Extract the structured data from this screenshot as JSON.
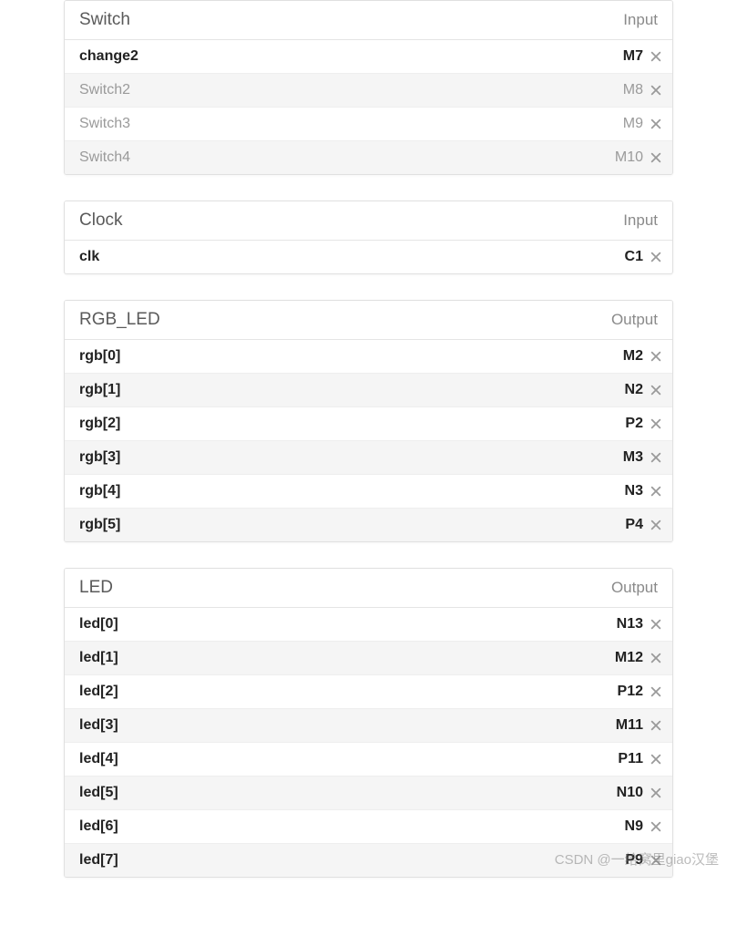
{
  "watermark": "CSDN @一给窝里giao汉堡",
  "panels": [
    {
      "title": "Switch",
      "direction": "Input",
      "rows": [
        {
          "name": "change2",
          "pin": "M7",
          "disabled": false,
          "alt": false
        },
        {
          "name": "Switch2",
          "pin": "M8",
          "disabled": true,
          "alt": true
        },
        {
          "name": "Switch3",
          "pin": "M9",
          "disabled": true,
          "alt": false
        },
        {
          "name": "Switch4",
          "pin": "M10",
          "disabled": true,
          "alt": true
        }
      ]
    },
    {
      "title": "Clock",
      "direction": "Input",
      "rows": [
        {
          "name": "clk",
          "pin": "C1",
          "disabled": false,
          "alt": false
        }
      ]
    },
    {
      "title": "RGB_LED",
      "direction": "Output",
      "rows": [
        {
          "name": "rgb[0]",
          "pin": "M2",
          "disabled": false,
          "alt": false
        },
        {
          "name": "rgb[1]",
          "pin": "N2",
          "disabled": false,
          "alt": true
        },
        {
          "name": "rgb[2]",
          "pin": "P2",
          "disabled": false,
          "alt": false
        },
        {
          "name": "rgb[3]",
          "pin": "M3",
          "disabled": false,
          "alt": true
        },
        {
          "name": "rgb[4]",
          "pin": "N3",
          "disabled": false,
          "alt": false
        },
        {
          "name": "rgb[5]",
          "pin": "P4",
          "disabled": false,
          "alt": true
        }
      ]
    },
    {
      "title": "LED",
      "direction": "Output",
      "rows": [
        {
          "name": "led[0]",
          "pin": "N13",
          "disabled": false,
          "alt": false
        },
        {
          "name": "led[1]",
          "pin": "M12",
          "disabled": false,
          "alt": true
        },
        {
          "name": "led[2]",
          "pin": "P12",
          "disabled": false,
          "alt": false
        },
        {
          "name": "led[3]",
          "pin": "M11",
          "disabled": false,
          "alt": true
        },
        {
          "name": "led[4]",
          "pin": "P11",
          "disabled": false,
          "alt": false
        },
        {
          "name": "led[5]",
          "pin": "N10",
          "disabled": false,
          "alt": true
        },
        {
          "name": "led[6]",
          "pin": "N9",
          "disabled": false,
          "alt": false
        },
        {
          "name": "led[7]",
          "pin": "P9",
          "disabled": false,
          "alt": true
        }
      ]
    }
  ]
}
